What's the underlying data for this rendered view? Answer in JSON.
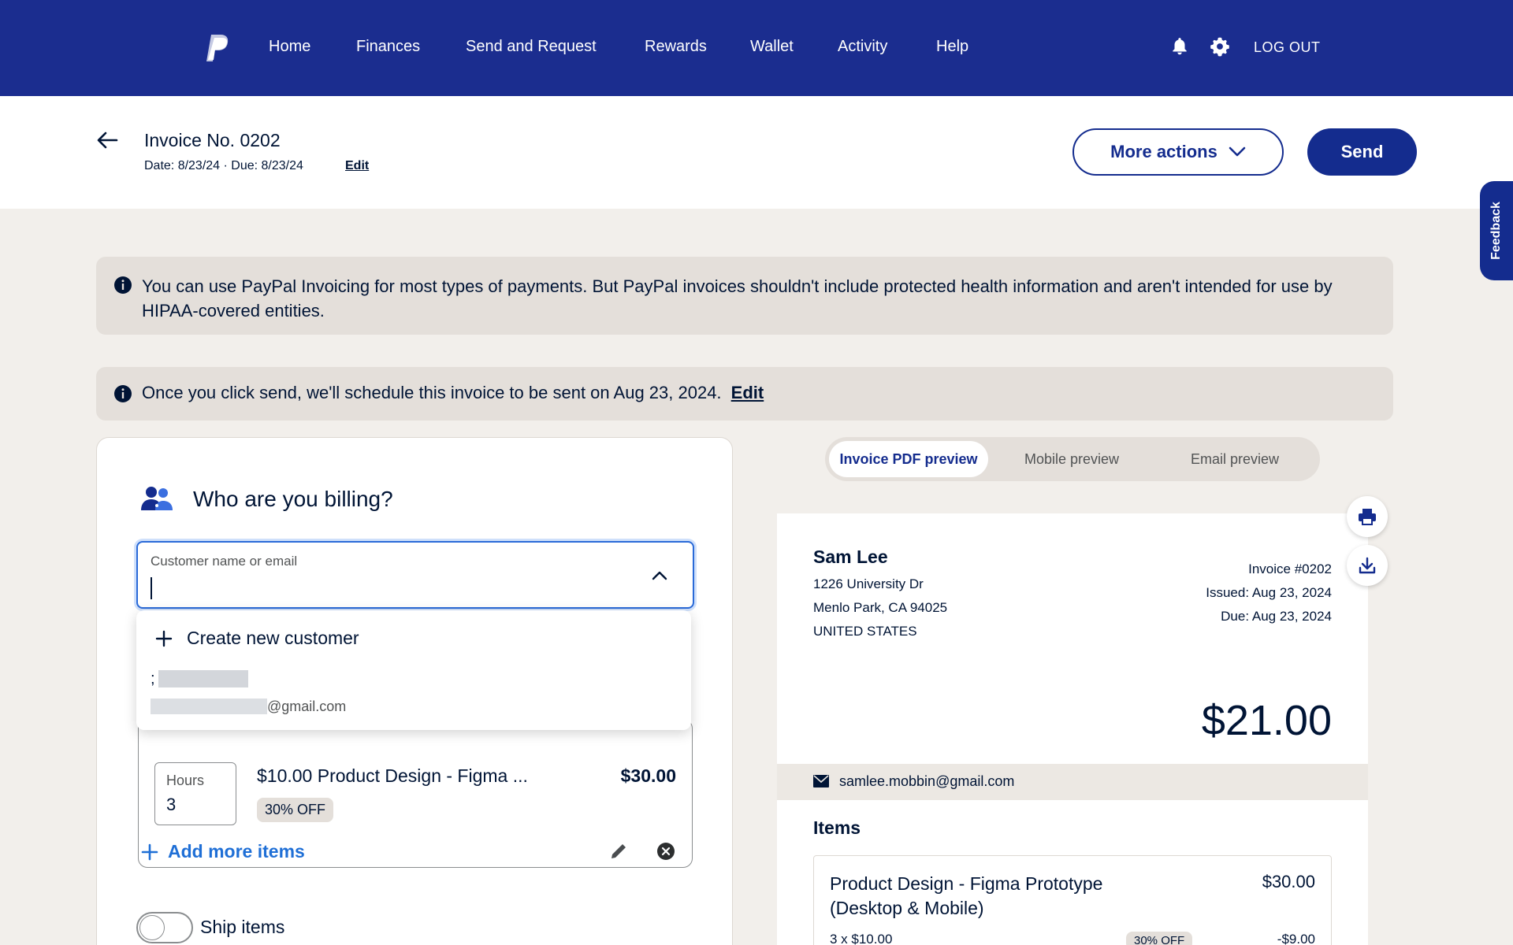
{
  "nav": {
    "items": [
      "Home",
      "Finances",
      "Send and Request",
      "Rewards",
      "Wallet",
      "Activity",
      "Help"
    ],
    "logout": "LOG OUT"
  },
  "invoice": {
    "title": "Invoice No. 0202",
    "dates": "Date: 8/23/24 · Due: 8/23/24",
    "edit": "Edit",
    "more_actions": "More actions",
    "send": "Send"
  },
  "feedback": "Feedback",
  "alerts": {
    "hipaa": "You can use PayPal Invoicing for most types of payments. But PayPal invoices shouldn't include protected health information and aren't intended for use by HIPAA-covered entities.",
    "schedule": "Once you click send, we'll schedule this invoice to be sent on Aug 23, 2024.",
    "schedule_edit": "Edit"
  },
  "billing": {
    "title": "Who are you billing?",
    "input_label": "Customer name or email",
    "dropdown_create": "Create new customer",
    "dropdown_customer_prefix": ";",
    "dropdown_customer_email": "@gmail.com"
  },
  "item": {
    "hours_label": "Hours",
    "hours_value": "3",
    "name": "$10.00 Product Design - Figma ...",
    "price": "$30.00",
    "discount_badge": "30% OFF"
  },
  "add_more": "Add more items",
  "ship_items": "Ship items",
  "preview_tabs": [
    "Invoice PDF preview",
    "Mobile preview",
    "Email preview"
  ],
  "preview": {
    "name": "Sam Lee",
    "address": [
      "1226 University Dr",
      "Menlo Park, CA 94025",
      "UNITED STATES"
    ],
    "invoice_no": "Invoice #0202",
    "issued": "Issued: Aug 23, 2024",
    "due": "Due: Aug 23, 2024",
    "total": "$21.00",
    "email": "samlee.mobbin@gmail.com",
    "items_heading": "Items",
    "item_name": "Product Design - Figma Prototype (Desktop & Mobile)",
    "item_price": "$30.00",
    "item_qty": "3 x $10.00",
    "item_off": "30% OFF",
    "item_discount": "-$9.00"
  },
  "colors": {
    "nav_bg": "#1b2d8f",
    "primary": "#142c8e",
    "link_blue": "#1f6fd6"
  }
}
